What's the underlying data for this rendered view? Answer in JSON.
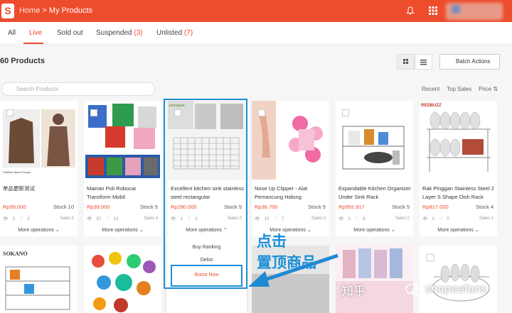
{
  "header": {
    "home": "Home",
    "separator": ">",
    "title": "My Products"
  },
  "tabs": [
    {
      "label": "All",
      "count": ""
    },
    {
      "label": "Live",
      "count": ""
    },
    {
      "label": "Sold out",
      "count": ""
    },
    {
      "label": "Suspended",
      "count": "(3)"
    },
    {
      "label": "Unlisted",
      "count": "(7)"
    }
  ],
  "product_count": "60 Products",
  "batch_label": "Batch Actions",
  "search_placeholder": "Search Products",
  "sort": [
    "Recent",
    "Top Sales",
    "Price"
  ],
  "more_label": "More operations",
  "products": [
    {
      "name": "单品更新测试",
      "price": "Rp99.000",
      "stock": "Stock 10",
      "views": "0",
      "likes": "0",
      "sales": "Sales 0"
    },
    {
      "name": "Mainan Poli Robocar Transform Mobil",
      "price": "Rp39.000",
      "stock": "Stock 5",
      "views": "87",
      "likes": "13",
      "sales": "Sales 4"
    },
    {
      "name": "Excellent kitchen sink stainless steel rectangular",
      "price": "Rp280.000",
      "stock": "Stock 5",
      "views": "1",
      "likes": "0",
      "sales": "Sales 0"
    },
    {
      "name": "Nose Up Clipper - Alat Pemancung Hidung",
      "price": "Rp36.700",
      "stock": "Stock 5",
      "views": "10",
      "likes": "7",
      "sales": "Sales 0"
    },
    {
      "name": "Expandable Kitchen Organizer Under Sink Rack",
      "price": "Rp991.917",
      "stock": "Stock 5",
      "views": "0",
      "likes": "9",
      "sales": "Sales 0"
    },
    {
      "name": "Rak Pinggan Stainless Steel 2 Layer S Shape Dish Rack",
      "price": "Rp817.000",
      "stock": "Stock 4",
      "views": "0",
      "likes": "0",
      "sales": "Sales 1"
    }
  ],
  "dropdown": {
    "buy_ranking": "Buy Ranking",
    "delist": "Delist",
    "boost": "Boost Now"
  },
  "annotation": {
    "line1": "点击",
    "line2": "置顶商品"
  },
  "watermark": {
    "zhihu": "知乎",
    "account": "shopeefans"
  },
  "img_text": {
    "p1": "Fashion Sport Croops",
    "p3": "pineapple",
    "p6": "REDBUZZ",
    "r1": "SOKANO"
  },
  "colors": {
    "brand": "#ee4d2d",
    "annotation": "#1e90d6"
  }
}
